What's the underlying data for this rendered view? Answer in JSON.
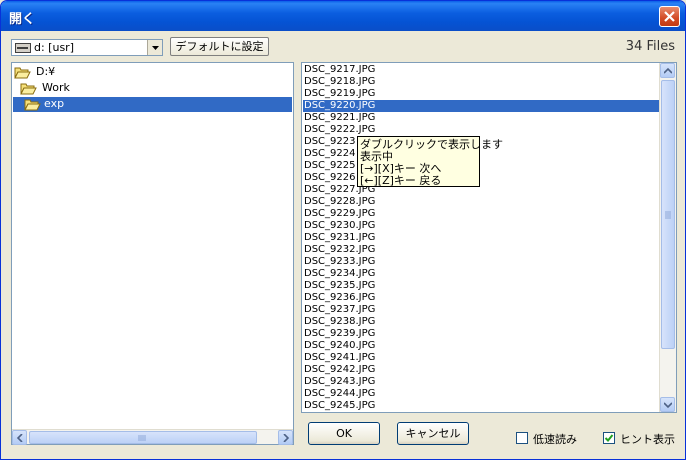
{
  "window": {
    "title": "開く",
    "close_icon": "close-icon"
  },
  "toolbar": {
    "drive_value": "d: [usr]",
    "default_button": "デフォルトに設定",
    "files_count": "34 Files"
  },
  "tree": {
    "items": [
      {
        "label": "D:¥",
        "icon": "folder-open-icon",
        "selected": false
      },
      {
        "label": "Work",
        "icon": "folder-open-icon",
        "selected": false
      },
      {
        "label": "exp",
        "icon": "folder-open-icon",
        "selected": true
      }
    ]
  },
  "files": {
    "items": [
      "DSC_9217.JPG",
      "DSC_9218.JPG",
      "DSC_9219.JPG",
      "DSC_9220.JPG",
      "DSC_9221.JPG",
      "DSC_9222.JPG",
      "DSC_9223",
      "DSC_9224",
      "DSC_9225",
      "DSC_9226",
      "DSC_9227.JPG",
      "DSC_9228.JPG",
      "DSC_9229.JPG",
      "DSC_9230.JPG",
      "DSC_9231.JPG",
      "DSC_9232.JPG",
      "DSC_9233.JPG",
      "DSC_9234.JPG",
      "DSC_9235.JPG",
      "DSC_9236.JPG",
      "DSC_9237.JPG",
      "DSC_9238.JPG",
      "DSC_9239.JPG",
      "DSC_9240.JPG",
      "DSC_9241.JPG",
      "DSC_9242.JPG",
      "DSC_9243.JPG",
      "DSC_9244.JPG",
      "DSC_9245.JPG"
    ],
    "selected_index": 3
  },
  "tooltip": {
    "lines": [
      "ダブルクリックで表示します",
      "表示中",
      "[→][X]キー 次へ",
      "[←][Z]キー 戻る"
    ]
  },
  "buttons": {
    "ok": "OK",
    "cancel": "キャンセル"
  },
  "options": {
    "low_speed": {
      "label": "低速読み",
      "checked": false
    },
    "hint": {
      "label": "ヒント表示",
      "checked": true
    }
  },
  "colors": {
    "selection": "#316ac5",
    "titlebar": "#0553d4",
    "tooltip_bg": "#ffffe1"
  }
}
